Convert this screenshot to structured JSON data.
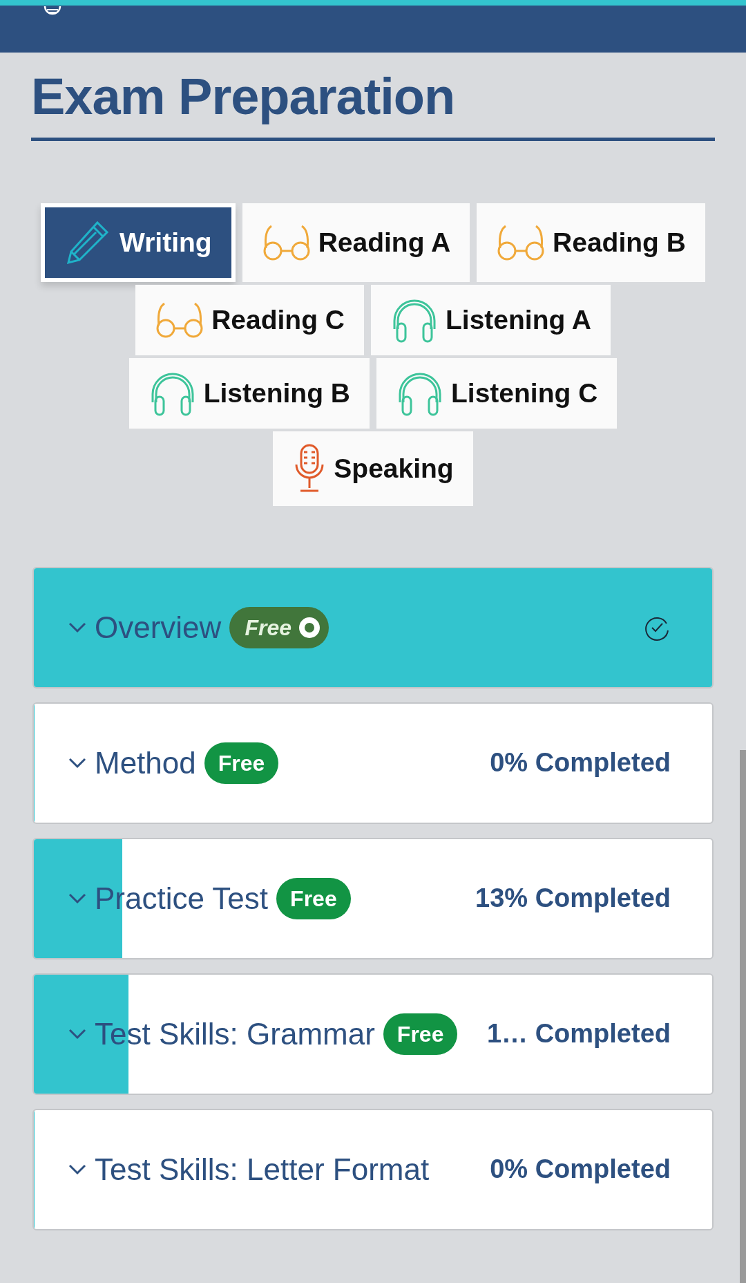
{
  "page": {
    "title": "Exam Preparation"
  },
  "tabs": [
    {
      "label": "Writing",
      "kind": "pencil",
      "selected": true
    },
    {
      "label": "Reading A",
      "kind": "glasses",
      "selected": false
    },
    {
      "label": "Reading B",
      "kind": "glasses",
      "selected": false
    },
    {
      "label": "Reading C",
      "kind": "glasses",
      "selected": false
    },
    {
      "label": "Listening A",
      "kind": "headphones",
      "selected": false
    },
    {
      "label": "Listening B",
      "kind": "headphones",
      "selected": false
    },
    {
      "label": "Listening C",
      "kind": "headphones",
      "selected": false
    },
    {
      "label": "Speaking",
      "kind": "microphone",
      "selected": false
    }
  ],
  "sections": [
    {
      "title": "Overview",
      "badge": {
        "text": "Free",
        "kind": "done"
      },
      "level": 1,
      "completed": true
    },
    {
      "title": "Method",
      "badge": {
        "text": "Free",
        "kind": "free"
      },
      "completion": "0% Completed",
      "level": 0,
      "completed": false
    },
    {
      "title": "Practice Test",
      "badge": {
        "text": "Free",
        "kind": "free"
      },
      "completion": "13% Completed",
      "level": 0.13,
      "completed": false
    },
    {
      "title": "Test Skills: Grammar",
      "badge": {
        "text": "Free",
        "kind": "free"
      },
      "completion": "1… Completed",
      "level": 0.14,
      "completed": false
    },
    {
      "title": "Test Skills: Letter Format",
      "completion": "0% Completed",
      "level": 0,
      "completed": false
    }
  ]
}
